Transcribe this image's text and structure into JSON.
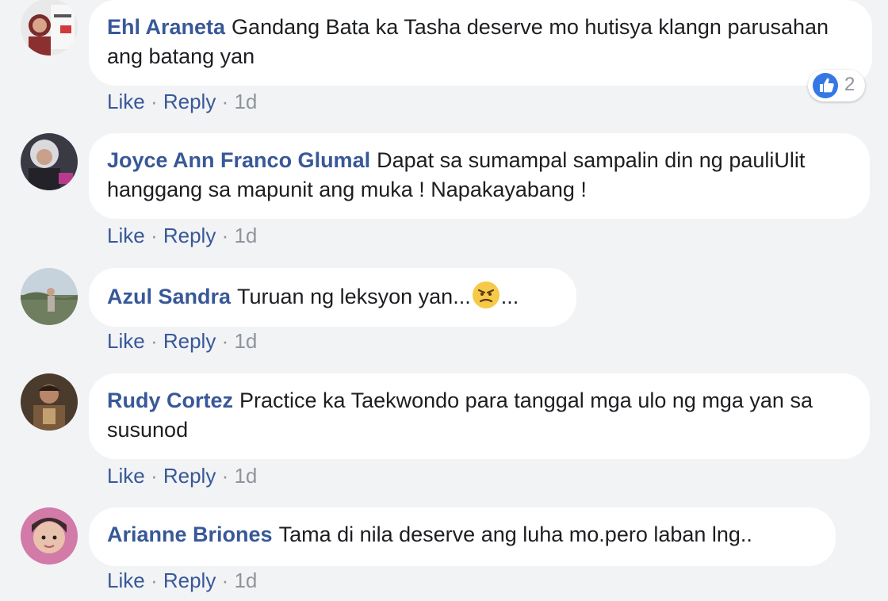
{
  "comments": [
    {
      "author": "Ehl Araneta",
      "text": "Gandang Bata ka Tasha deserve mo hutisya klangn parusahan ang batang yan",
      "actions": {
        "like": "Like",
        "reply": "Reply",
        "time": "1d"
      },
      "reaction_count": "2"
    },
    {
      "author": "Joyce Ann Franco Glumal",
      "text": "Dapat sa sumampal sampalin din ng pauliUlit hanggang sa mapunit ang muka ! Napakayabang !",
      "actions": {
        "like": "Like",
        "reply": "Reply",
        "time": "1d"
      }
    },
    {
      "author": "Azul Sandra",
      "text_before": "Turuan ng leksyon yan...",
      "text_after": "...",
      "actions": {
        "like": "Like",
        "reply": "Reply",
        "time": "1d"
      }
    },
    {
      "author": "Rudy Cortez",
      "text": "Practice ka Taekwondo para tanggal mga ulo ng mga yan sa susunod",
      "actions": {
        "like": "Like",
        "reply": "Reply",
        "time": "1d"
      }
    },
    {
      "author": "Arianne Briones",
      "text": "Tama di nila deserve ang luha mo.pero laban lng..",
      "actions": {
        "like": "Like",
        "reply": "Reply",
        "time": "1d"
      }
    }
  ],
  "separator": "·",
  "colors": {
    "author": "#385898",
    "background": "#f2f3f5",
    "like_blue": "#3578e5"
  },
  "icons": {
    "reaction": "thumbs-up-icon",
    "emoji": "angry-face-icon"
  }
}
